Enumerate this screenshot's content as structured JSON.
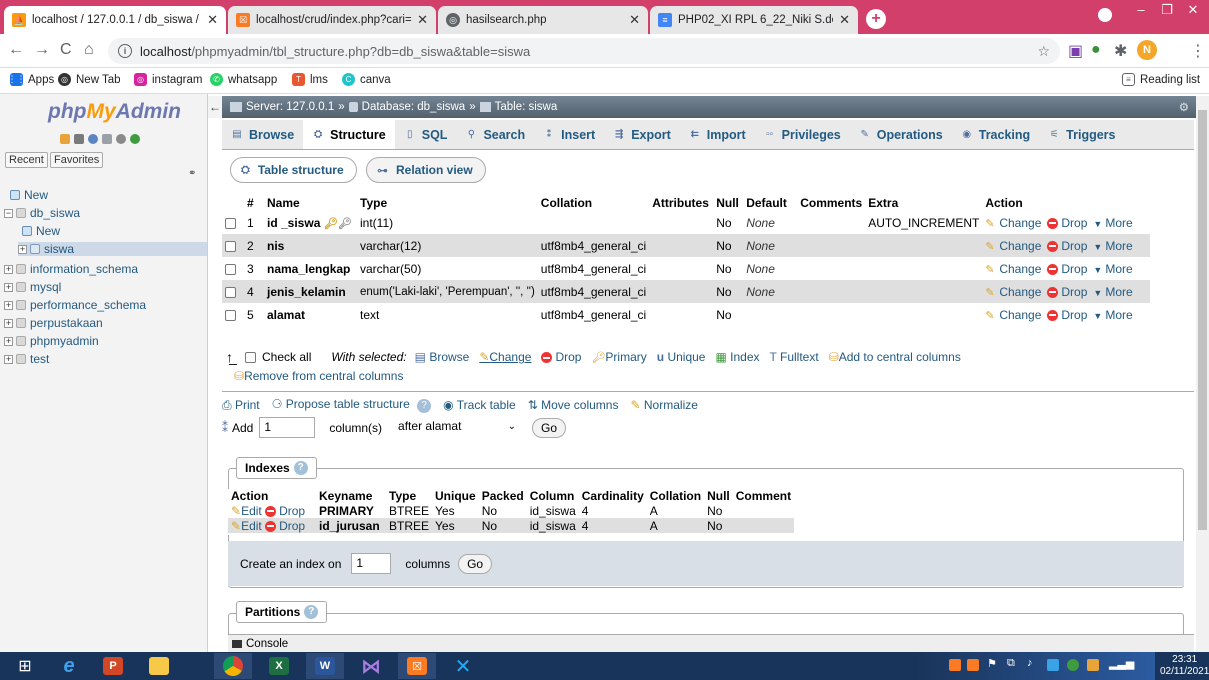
{
  "browser": {
    "tabs": [
      {
        "title": "localhost / 127.0.0.1 / db_siswa /",
        "active": true,
        "favicon": "phpmyadmin-icon",
        "favcolor": "#f89c0e"
      },
      {
        "title": "localhost/crud/index.php?cari=N",
        "active": false,
        "favicon": "xampp-icon",
        "favcolor": "#fb7a24"
      },
      {
        "title": "hasilsearch.php",
        "active": false,
        "favicon": "globe-icon",
        "favcolor": "#5f6368"
      },
      {
        "title": "PHP02_XI RPL 6_22_Niki S.docx -",
        "active": false,
        "favicon": "docs-icon",
        "favcolor": "#4285f4"
      }
    ],
    "url_host": "localhost",
    "url_rest": "/phpmyadmin/tbl_structure.php?db=db_siswa&table=siswa",
    "profile_initial": "N",
    "bookmarks": [
      "Apps",
      "New Tab",
      "instagram",
      "whatsapp",
      "lms",
      "canva"
    ],
    "reading_list": "Reading list"
  },
  "sidebar": {
    "logo_php": "php",
    "logo_my": "My",
    "logo_admin": "Admin",
    "recent": "Recent",
    "favorites": "Favorites",
    "tree": [
      {
        "label": "New",
        "indent": 0
      },
      {
        "label": "db_siswa",
        "indent": 0
      },
      {
        "label": "New",
        "indent": 1
      },
      {
        "label": "siswa",
        "indent": 1
      },
      {
        "label": "information_schema",
        "indent": 0
      },
      {
        "label": "mysql",
        "indent": 0
      },
      {
        "label": "performance_schema",
        "indent": 0
      },
      {
        "label": "perpustakaan",
        "indent": 0
      },
      {
        "label": "phpmyadmin",
        "indent": 0
      },
      {
        "label": "test",
        "indent": 0
      }
    ]
  },
  "breadcrumb": {
    "server": "Server: 127.0.0.1",
    "database": "Database: db_siswa",
    "table": "Table: siswa"
  },
  "topmenu": [
    "Browse",
    "Structure",
    "SQL",
    "Search",
    "Insert",
    "Export",
    "Import",
    "Privileges",
    "Operations",
    "Tracking",
    "Triggers"
  ],
  "subtabs": [
    "Table structure",
    "Relation view"
  ],
  "structure": {
    "headers": [
      "#",
      "Name",
      "Type",
      "Collation",
      "Attributes",
      "Null",
      "Default",
      "Comments",
      "Extra",
      "Action"
    ],
    "rows": [
      {
        "num": "1",
        "name": "id _siswa",
        "type": "int(11)",
        "collation": "",
        "null": "No",
        "default": "None",
        "extra": "AUTO_INCREMENT"
      },
      {
        "num": "2",
        "name": "nis",
        "type": "varchar(12)",
        "collation": "utf8mb4_general_ci",
        "null": "No",
        "default": "None",
        "extra": ""
      },
      {
        "num": "3",
        "name": "nama_lengkap",
        "type": "varchar(50)",
        "collation": "utf8mb4_general_ci",
        "null": "No",
        "default": "None",
        "extra": ""
      },
      {
        "num": "4",
        "name": "jenis_kelamin",
        "type": "enum('Laki-laki', 'Perempuan', '', '')",
        "collation": "utf8mb4_general_ci",
        "null": "No",
        "default": "None",
        "extra": ""
      },
      {
        "num": "5",
        "name": "alamat",
        "type": "text",
        "collation": "utf8mb4_general_ci",
        "null": "No",
        "default": "",
        "extra": ""
      }
    ],
    "action_change": "Change",
    "action_drop": "Drop",
    "action_more": "More"
  },
  "bulk": {
    "check_all": "Check all",
    "with_selected": "With selected:",
    "actions": [
      "Browse",
      "Change",
      "Drop",
      "Primary",
      "Unique",
      "Index",
      "Fulltext",
      "Add to central columns"
    ],
    "remove_central": "Remove from central columns"
  },
  "tools": [
    "Print",
    "Propose table structure",
    "Track table",
    "Move columns",
    "Normalize"
  ],
  "add": {
    "label": "Add",
    "value": "1",
    "columns": "column(s)",
    "position": "after alamat",
    "go": "Go"
  },
  "indexes": {
    "legend": "Indexes",
    "headers": [
      "Action",
      "Keyname",
      "Type",
      "Unique",
      "Packed",
      "Column",
      "Cardinality",
      "Collation",
      "Null",
      "Comment"
    ],
    "rows": [
      {
        "keyname": "PRIMARY",
        "type": "BTREE",
        "unique": "Yes",
        "packed": "No",
        "column": "id_siswa",
        "cardinality": "4",
        "collation": "A",
        "null": "No"
      },
      {
        "keyname": "id_jurusan",
        "type": "BTREE",
        "unique": "Yes",
        "packed": "No",
        "column": "id_siswa",
        "cardinality": "4",
        "collation": "A",
        "null": "No"
      }
    ],
    "edit": "Edit",
    "drop": "Drop",
    "create_label": "Create an index on",
    "create_value": "1",
    "create_columns": "columns",
    "go": "Go"
  },
  "partitions": {
    "legend": "Partitions"
  },
  "console": "Console",
  "clock": {
    "time": "23:31",
    "date": "02/11/2021"
  }
}
